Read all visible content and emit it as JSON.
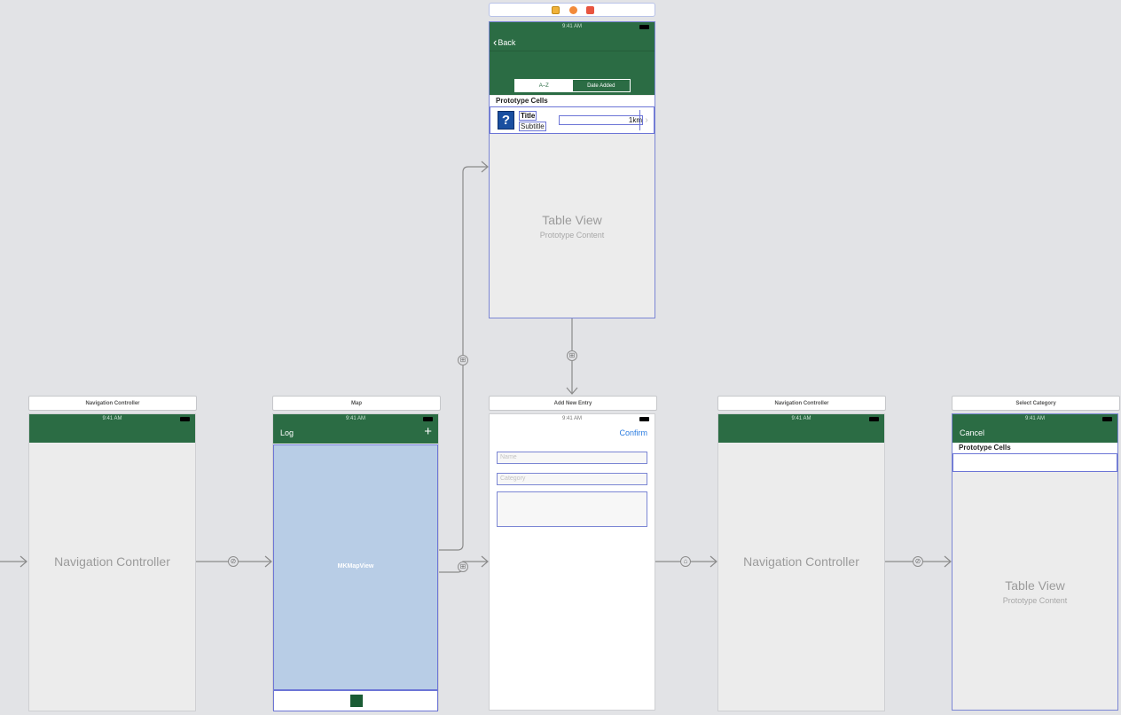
{
  "scene_dock": {
    "icons": [
      "view-controller-icon",
      "first-responder-icon",
      "exit-icon"
    ]
  },
  "status_time": "9:41 AM",
  "list_scene": {
    "back_label": "Back",
    "segments": [
      "A–Z",
      "Date Added"
    ],
    "prototype_header": "Prototype Cells",
    "cell_title": "Title",
    "cell_subtitle": "Subtitle",
    "cell_distance": "1km",
    "table_title": "Table View",
    "table_subtitle": "Prototype Content"
  },
  "nav_scene_1": {
    "title": "Navigation Controller",
    "label": "Navigation Controller"
  },
  "map_scene": {
    "title": "Map",
    "left_button": "Log",
    "add_button": "+",
    "map_label": "MKMapView"
  },
  "add_entry_scene": {
    "title": "Add New Entry",
    "confirm_label": "Confirm",
    "name_placeholder": "Name",
    "category_placeholder": "Category"
  },
  "nav_scene_2": {
    "title": "Navigation Controller",
    "label": "Navigation Controller"
  },
  "category_scene": {
    "title": "Select Category",
    "cancel_label": "Cancel",
    "prototype_header": "Prototype Cells",
    "table_title": "Table View",
    "table_subtitle": "Prototype Content"
  },
  "colors": {
    "nav_green": "#2b6c44",
    "segue_line": "#8a8a8a",
    "selection_blue": "#6c75d6",
    "map_fill": "#b8cde6"
  }
}
